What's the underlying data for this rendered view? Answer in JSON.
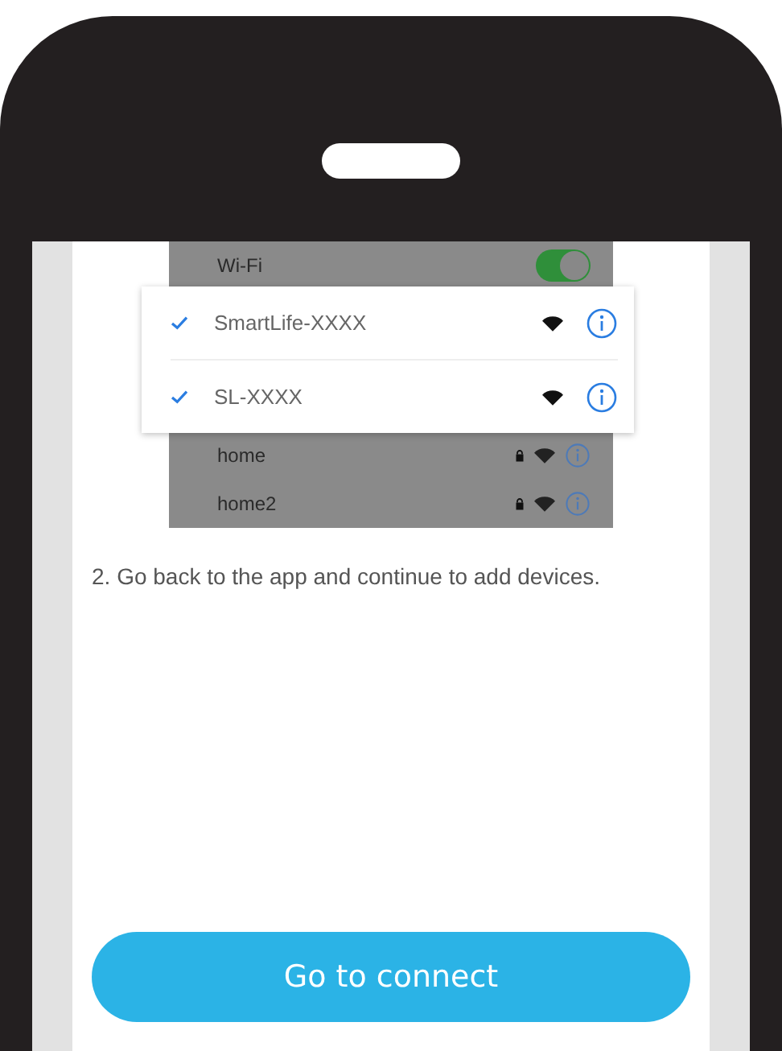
{
  "wifi_settings": {
    "title": "Wi-Fi",
    "toggle_on": true,
    "joined_networks": [
      {
        "name": "SmartLife-XXXX",
        "checked": true
      },
      {
        "name": "SL-XXXX",
        "checked": true
      }
    ],
    "other_networks": [
      {
        "name": "home",
        "locked": true
      },
      {
        "name": "home2",
        "locked": true
      }
    ]
  },
  "instruction": "2. Go back to the app and continue to add devices.",
  "button": "Go to connect"
}
